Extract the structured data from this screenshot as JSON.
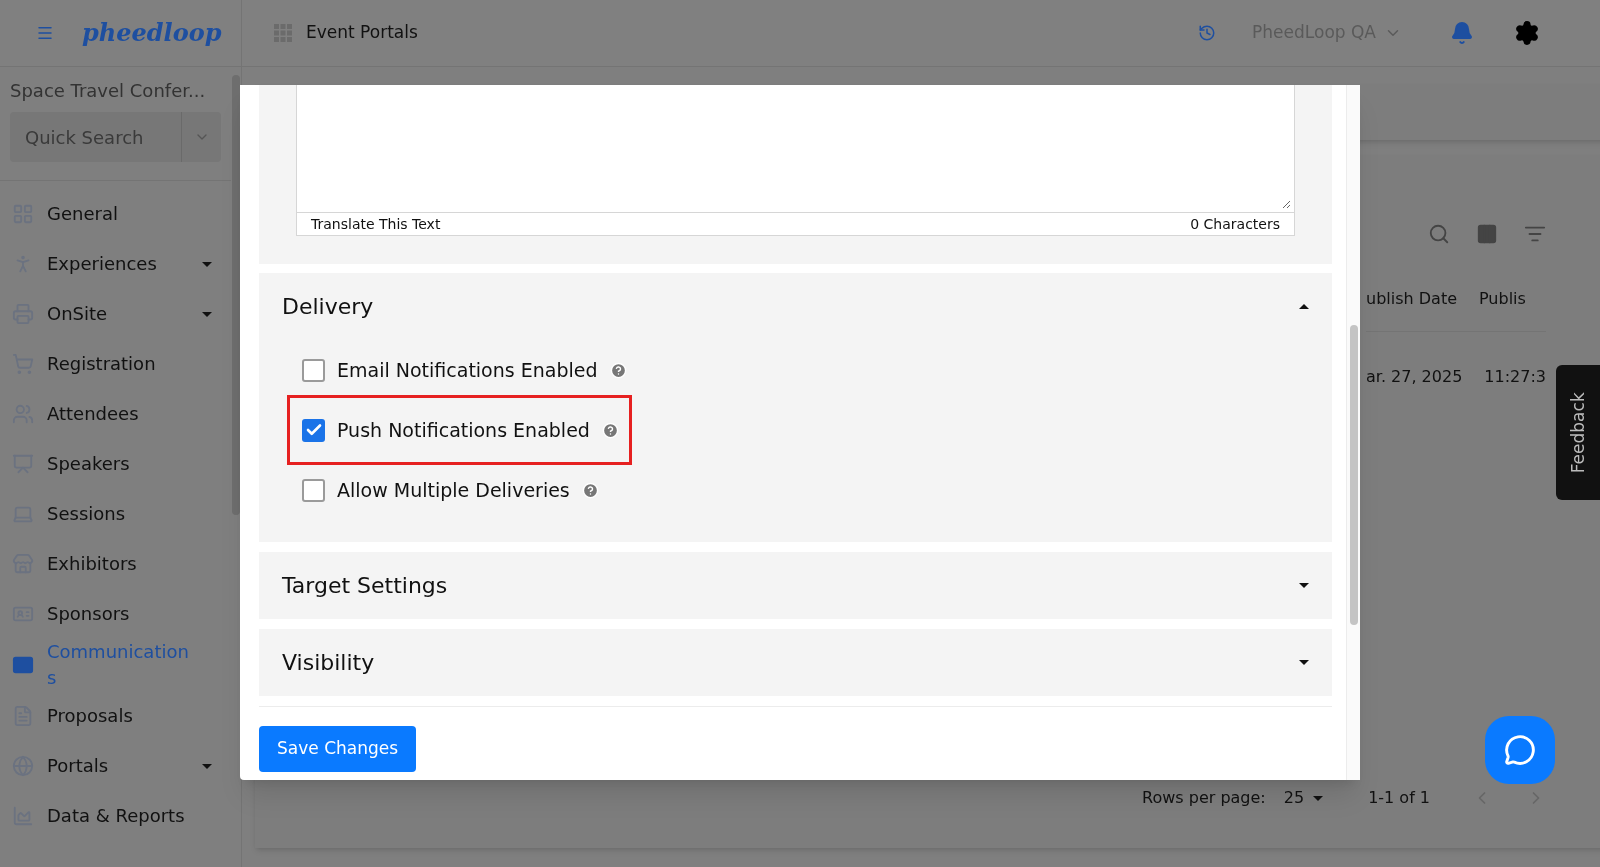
{
  "topbar": {
    "logo": "pheedloop",
    "nav_title": "Event Portals",
    "organization": "PheedLoop QA"
  },
  "sidebar": {
    "event_name": "Space Travel Confer...",
    "search": {
      "placeholder": "Quick Search"
    },
    "items": [
      {
        "label": "General",
        "expandable": false,
        "selected": false
      },
      {
        "label": "Experiences",
        "expandable": true,
        "selected": false
      },
      {
        "label": "OnSite",
        "expandable": true,
        "selected": false
      },
      {
        "label": "Registration",
        "expandable": false,
        "selected": false
      },
      {
        "label": "Attendees",
        "expandable": false,
        "selected": false
      },
      {
        "label": "Speakers",
        "expandable": false,
        "selected": false
      },
      {
        "label": "Sessions",
        "expandable": false,
        "selected": false
      },
      {
        "label": "Exhibitors",
        "expandable": false,
        "selected": false
      },
      {
        "label": "Sponsors",
        "expandable": false,
        "selected": false
      },
      {
        "label": "Communications",
        "expandable": false,
        "selected": true
      },
      {
        "label": "Proposals",
        "expandable": false,
        "selected": false
      },
      {
        "label": "Portals",
        "expandable": true,
        "selected": false
      },
      {
        "label": "Data & Reports",
        "expandable": false,
        "selected": false
      }
    ]
  },
  "table": {
    "columns": [
      "ublish Date",
      "Publis"
    ],
    "rows": [
      [
        "ar. 27, 2025",
        "11:27:3"
      ]
    ],
    "pagination": {
      "rows_per_page_label": "Rows per page:",
      "rows_per_page": "25",
      "range": "1-1 of 1"
    }
  },
  "feedback": "Feedback",
  "modal": {
    "translate_bar": {
      "left": "Translate This Text",
      "right": "0 Characters"
    },
    "sections": [
      {
        "title": "Delivery",
        "expanded": true,
        "options": [
          {
            "label": "Email Notifications Enabled",
            "checked": false,
            "highlighted": false
          },
          {
            "label": "Push Notifications Enabled",
            "checked": true,
            "highlighted": true
          },
          {
            "label": "Allow Multiple Deliveries",
            "checked": false,
            "highlighted": false
          }
        ]
      },
      {
        "title": "Target Settings",
        "expanded": false
      },
      {
        "title": "Visibility",
        "expanded": false
      }
    ],
    "save_button": "Save Changes"
  }
}
